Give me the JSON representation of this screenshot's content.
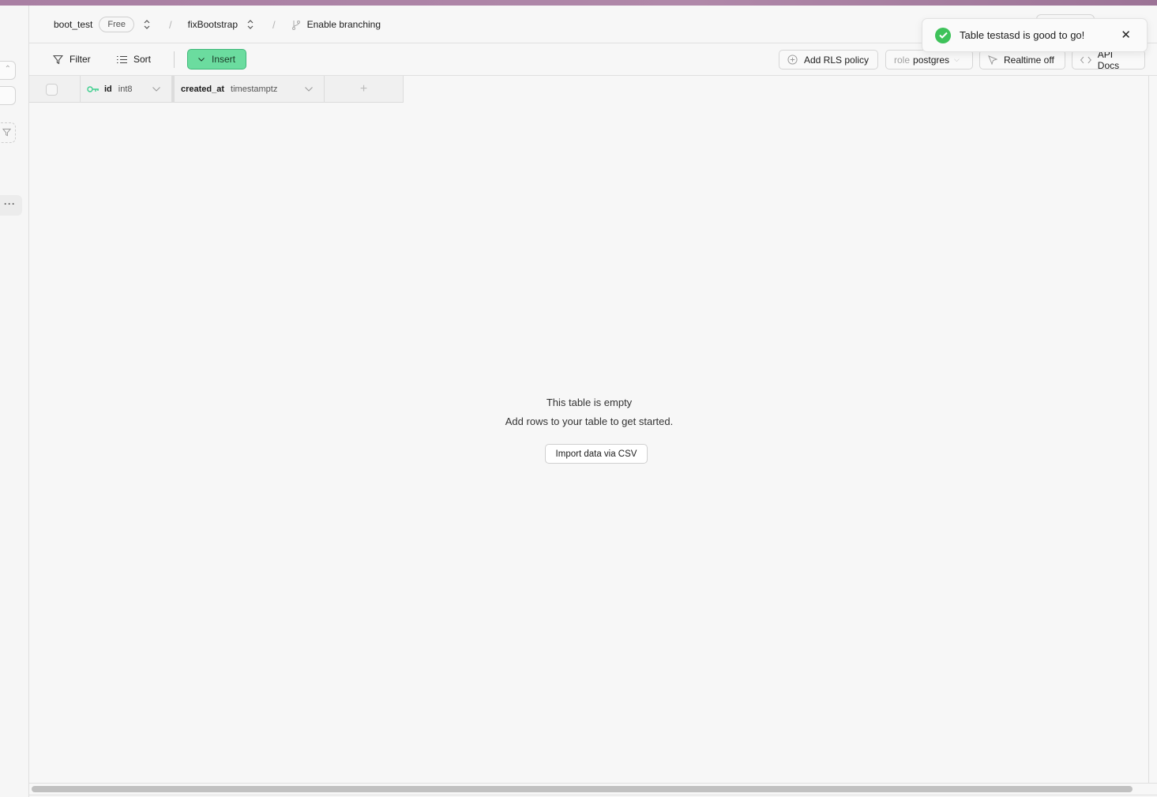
{
  "header": {
    "project_name": "boot_test",
    "plan_badge": "Free",
    "branch_name": "fixBootstrap",
    "enable_branching": "Enable branching"
  },
  "toolbar": {
    "filter_label": "Filter",
    "sort_label": "Sort",
    "insert_label": "Insert",
    "add_rls_label": "Add RLS policy",
    "role_prefix": "role",
    "role_value": "postgres",
    "realtime_label": "Realtime off",
    "api_docs_label": "API Docs"
  },
  "grid": {
    "columns": [
      {
        "name": "id",
        "type": "int8",
        "primary_key": true
      },
      {
        "name": "created_at",
        "type": "timestamptz",
        "primary_key": false
      }
    ],
    "add_column_symbol": "+"
  },
  "empty_state": {
    "title": "This table is empty",
    "subtitle": "Add rows to your table to get started.",
    "import_label": "Import data via CSV"
  },
  "toast": {
    "message": "Table testasd is good to go!",
    "status": "success",
    "close_symbol": "✕"
  },
  "left_rail": {
    "more_symbol": "···"
  },
  "colors": {
    "accent_green": "#6bdc9f",
    "success": "#3ec25a",
    "primary_key": "#3ecf8e"
  }
}
